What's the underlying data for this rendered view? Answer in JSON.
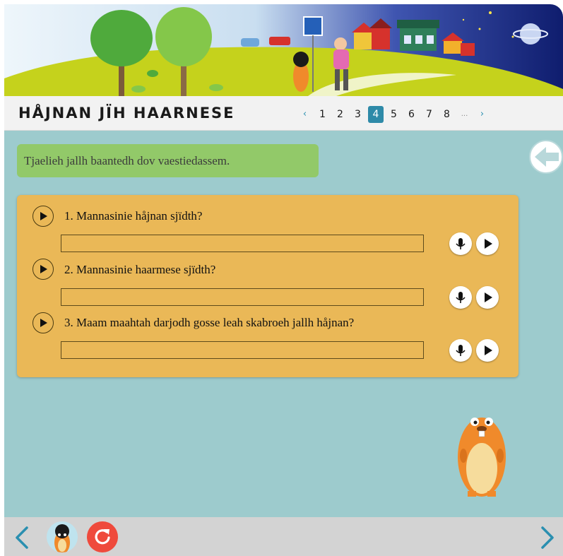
{
  "header": {
    "title": "HÅJNAN JÏH HAARNESE"
  },
  "pager": {
    "prev": "‹",
    "next": "›",
    "pages": [
      "1",
      "2",
      "3",
      "4",
      "5",
      "6",
      "7",
      "8"
    ],
    "current": "4",
    "ellipsis": "..."
  },
  "instruction": "Tjaelieh jallh baantedh dov vaestiedassem.",
  "questions": [
    {
      "text": "1.  Mannasinie håjnan sjïdth?",
      "answer": ""
    },
    {
      "text": "2. Mannasinie haarmese sjïdth?",
      "answer": ""
    },
    {
      "text": "3. Maam maahtah darjodh gosse leah skabroeh jallh håjnan?",
      "answer": ""
    }
  ],
  "icons": {
    "play": "play-icon",
    "record": "microphone-icon",
    "back": "arrow-left-icon",
    "reset": "refresh-icon"
  },
  "colors": {
    "content_bg": "#9dcbcd",
    "card_bg": "#eab857",
    "instruction_bg": "#92c969",
    "pager_active": "#2e8aa8",
    "reset": "#ef4a3c",
    "nav_arrow": "#2a8fb0"
  }
}
